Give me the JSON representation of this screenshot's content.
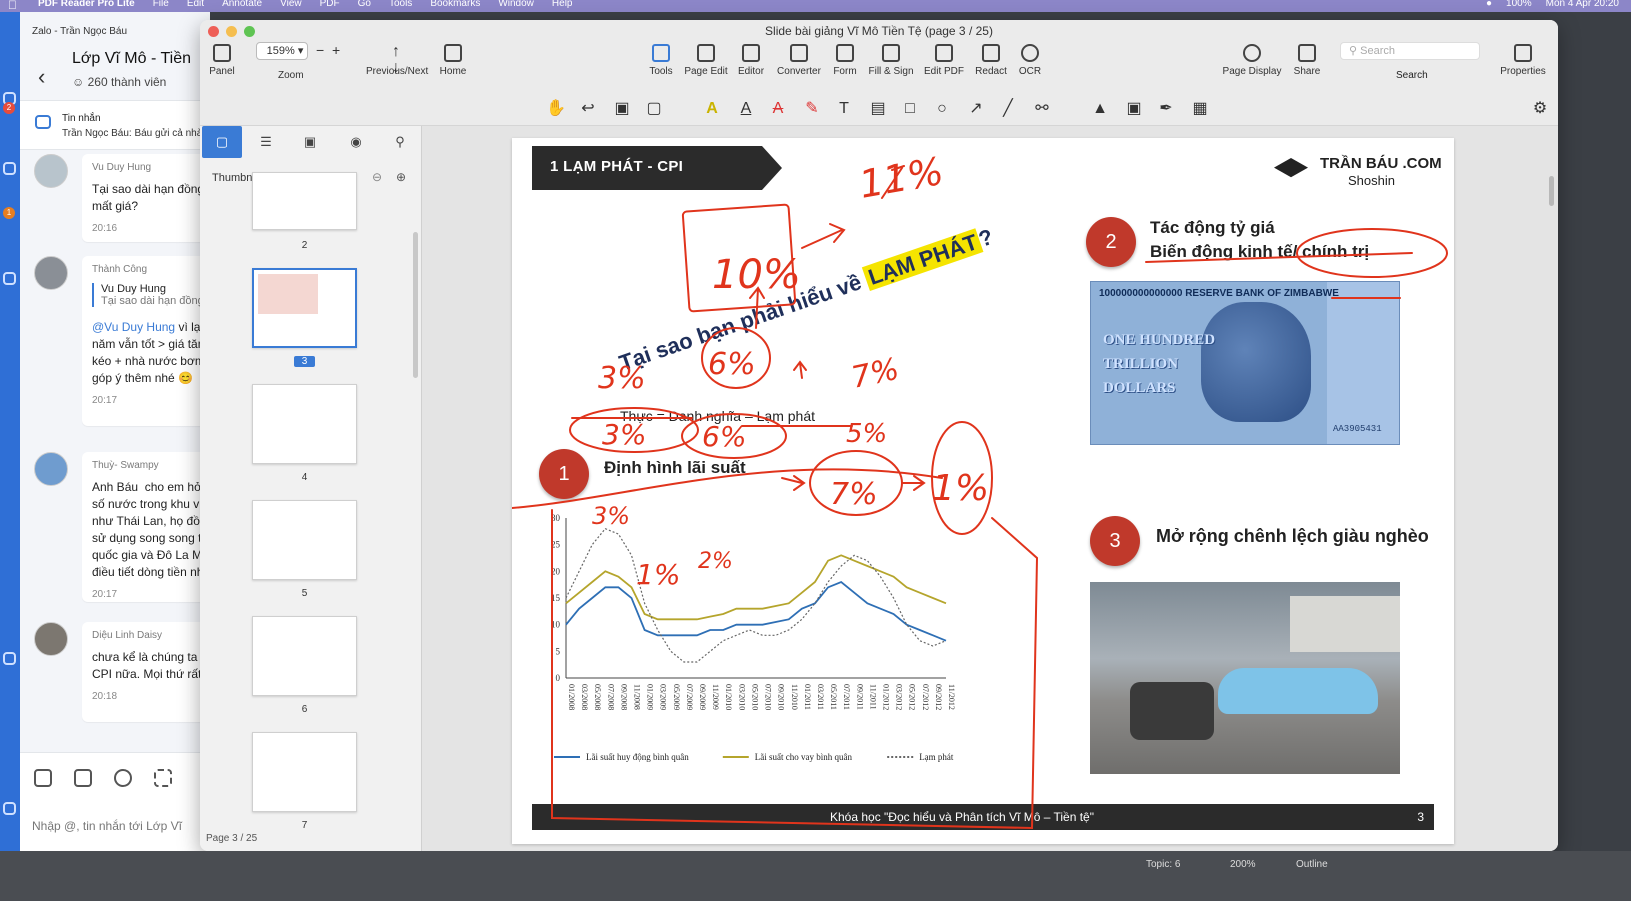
{
  "menubar": {
    "app": "PDF Reader Pro Lite",
    "items": [
      "File",
      "Edit",
      "Annotate",
      "View",
      "PDF",
      "Go",
      "Tools",
      "Bookmarks",
      "Window",
      "Help"
    ],
    "battery": "100%",
    "clock": "Mon 4 Apr  20:20"
  },
  "dock": {
    "badges": [
      "2",
      "1"
    ]
  },
  "zalo": {
    "window_title": "Zalo - Trần Ngọc Báu",
    "group_name": "Lớp Vĩ Mô - Tiền",
    "members": "260 thành viên",
    "pinned": {
      "title": "Tin nhắn",
      "snippet": "Trần Ngọc Báu: Báu gửi cả nhà"
    },
    "messages": [
      {
        "sender": "Vu Duy Hung",
        "avatar": "Lớp Vĩ Mô",
        "text": "Tại sao dài hạn đồng\nmất giá?",
        "time": "20:16"
      },
      {
        "sender": "Thành Công",
        "quote_name": "Vu Duy Hung",
        "quote_text": "Tại sao dài hạn đồng",
        "mention": "@Vu Duy Hung",
        "text": " vì lạm\nnăm vẫn tốt > giá tăn\nkéo + nhà nước bơm\ngóp ý thêm nhé 😊",
        "time": "20:17"
      },
      {
        "sender": "Thuỳ- Swampy",
        "text": "Anh Báu  cho em hỏi,\nsố nước trong khu vự\nnhư Thái Lan, họ đồng\nsử dụng song song tiề\nquốc gia và Đô La Mỹ\nđiều tiết dòng tiền như",
        "time": "20:17"
      },
      {
        "sender": "Diệu Linh Daisy",
        "text": "chưa kể là chúng ta tí\nCPI nữa. Mọi thứ rất r",
        "time": "20:18"
      }
    ],
    "composer_hint": "Nhập @, tin nhắn tới Lớp Vĩ"
  },
  "pdf": {
    "title": "Slide bài giảng Vĩ Mô Tiền Tệ (page 3 / 25)",
    "zoom": "159%",
    "toolbar": [
      {
        "label": "Panel",
        "icon": "panel-icon"
      },
      {
        "label": "Zoom",
        "icon": "zoom-icon"
      },
      {
        "label": "Previous/Next",
        "icon": "arrows-icon"
      },
      {
        "label": "Home",
        "icon": "home-icon"
      },
      {
        "label": "Tools",
        "icon": "toolbox-icon"
      },
      {
        "label": "Page Edit",
        "icon": "page-edit-icon"
      },
      {
        "label": "Editor",
        "icon": "editor-icon"
      },
      {
        "label": "Converter",
        "icon": "converter-icon"
      },
      {
        "label": "Form",
        "icon": "form-icon"
      },
      {
        "label": "Fill & Sign",
        "icon": "fill-sign-icon"
      },
      {
        "label": "Edit PDF",
        "icon": "edit-pdf-icon"
      },
      {
        "label": "Redact",
        "icon": "redact-icon"
      },
      {
        "label": "OCR",
        "icon": "ocr-icon"
      },
      {
        "label": "Page Display",
        "icon": "eye-icon"
      },
      {
        "label": "Share",
        "icon": "share-icon"
      },
      {
        "label": "Search",
        "icon": "search-icon"
      },
      {
        "label": "Properties",
        "icon": "properties-icon"
      }
    ],
    "search_placeholder": "Search",
    "sidepanel": {
      "title": "Thumbnails",
      "pages": [
        "2",
        "3",
        "4",
        "5",
        "6",
        "7"
      ],
      "selected": "3",
      "status": "Page 3 / 25"
    },
    "status": {
      "topic": "Topic: 6",
      "zoom": "200%",
      "outline": "Outline"
    }
  },
  "slide": {
    "section_label": "1   LẠM PHÁT - CPI",
    "brand": "TRẦN BÁU .COM",
    "brand_sub": "Shoshin",
    "question": "Tại sao bạn phải hiểu về",
    "question_highlight": "LẠM PHÁT",
    "question_mark": "?",
    "formula": "Thực = Danh nghĩa – Lạm phát",
    "point1_num": "1",
    "point1": "Định hình lãi suất",
    "point2_num": "2",
    "point2_line1": "Tác động tỷ giá",
    "point2_line2": "Biến động kinh tế/ chính trị",
    "point3_num": "3",
    "point3": "Mở rộng chênh lệch giàu nghèo",
    "banknote": {
      "bank": "100000000000000 RESERVE BANK OF ZIMBABWE",
      "amount": "ONE HUNDRED\nTRILLION\nDOLLARS",
      "serial": "AA3905431"
    },
    "footer": "Khóa học \"Đọc hiểu và Phân tích Vĩ Mô – Tiền tệ\"",
    "page": "3",
    "annotations": [
      "11%",
      "10%",
      "6%",
      "3%",
      "7%",
      "3%",
      "6%",
      "5%",
      "7%",
      "1%",
      "3%",
      "1%",
      "2%"
    ]
  },
  "chart_data": {
    "type": "line",
    "x": [
      "01/2008",
      "03/2008",
      "05/2008",
      "07/2008",
      "09/2008",
      "11/2008",
      "01/2009",
      "03/2009",
      "05/2009",
      "07/2009",
      "09/2009",
      "11/2009",
      "01/2010",
      "03/2010",
      "05/2010",
      "07/2010",
      "09/2010",
      "11/2010",
      "01/2011",
      "03/2011",
      "05/2011",
      "07/2011",
      "09/2011",
      "11/2011",
      "01/2012",
      "03/2012",
      "05/2012",
      "07/2012",
      "09/2012",
      "11/2012"
    ],
    "ylim": [
      0,
      30
    ],
    "yticks": [
      0,
      5,
      10,
      15,
      20,
      25,
      30
    ],
    "series": [
      {
        "name": "Lãi suất huy động bình quân",
        "color": "#2e6fb5",
        "style": "solid",
        "values": [
          10,
          13,
          15,
          17,
          17,
          15,
          9,
          8,
          8,
          8,
          8,
          9,
          9,
          10,
          10,
          10,
          10.5,
          11,
          13,
          14,
          17,
          18,
          16,
          14,
          13,
          12,
          10,
          9,
          8,
          7
        ]
      },
      {
        "name": "Lãi suất cho vay bình quân",
        "color": "#b5a52c",
        "style": "solid",
        "values": [
          14,
          16,
          18,
          20,
          19,
          17,
          12,
          11,
          11,
          11,
          11,
          11.5,
          12,
          13,
          13,
          13,
          13.5,
          14,
          16,
          18,
          22,
          23,
          22,
          21,
          20,
          19,
          17,
          16,
          15,
          14
        ]
      },
      {
        "name": "Lạm phát",
        "color": "#666666",
        "style": "dotted",
        "values": [
          15,
          20,
          25,
          28,
          27,
          23,
          14,
          9,
          5,
          3,
          3,
          5,
          7,
          8,
          9,
          8,
          8,
          9,
          11,
          14,
          18,
          21,
          23,
          22,
          19,
          15,
          10,
          7,
          6,
          7
        ]
      }
    ],
    "legend": "bottom"
  }
}
